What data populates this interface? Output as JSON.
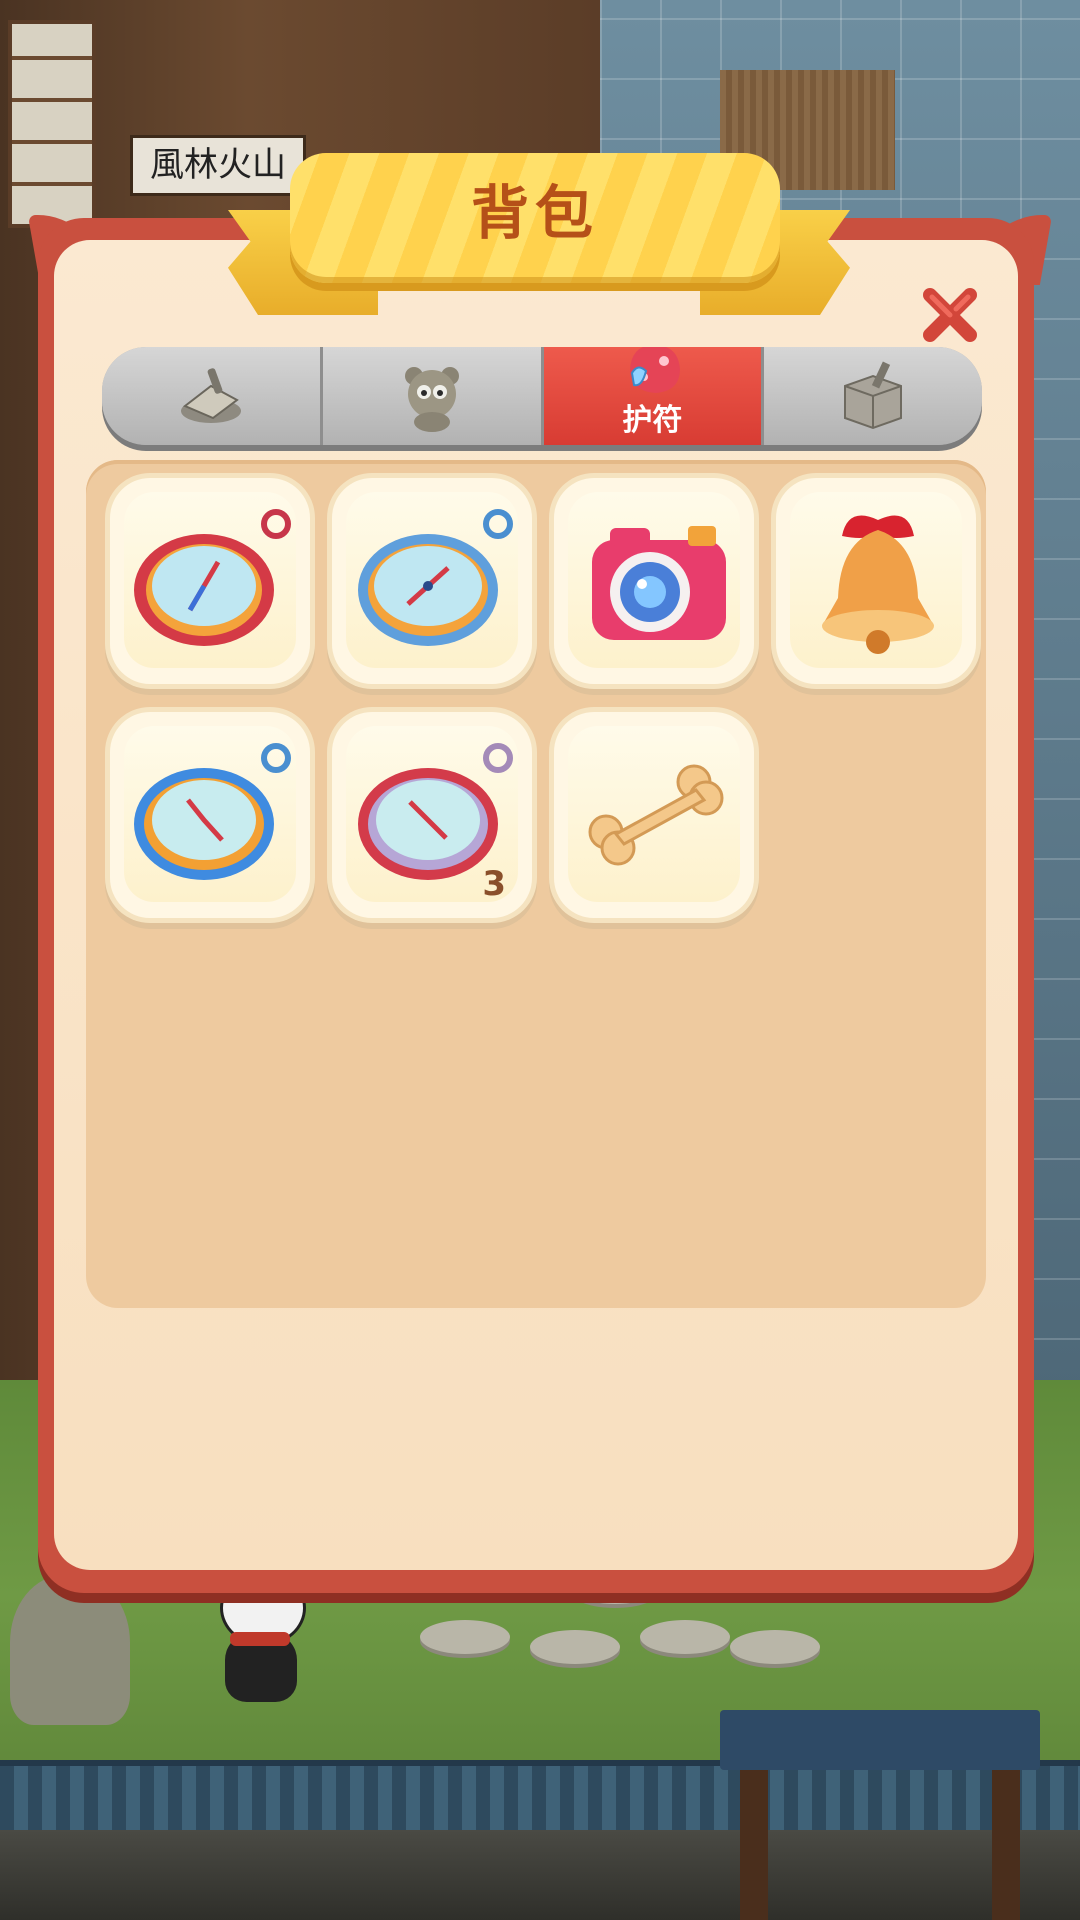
{
  "scene": {
    "sign_text": "風林火山"
  },
  "panel": {
    "title": "背包",
    "close_icon": "close-x-icon"
  },
  "tabs": [
    {
      "icon": "scroll-tools-icon",
      "label": "",
      "active": false
    },
    {
      "icon": "teddy-bear-icon",
      "label": "",
      "active": false
    },
    {
      "icon": "charm-pouch-icon",
      "label": "护符",
      "active": true
    },
    {
      "icon": "crate-icon",
      "label": "",
      "active": false
    }
  ],
  "items": [
    {
      "icon": "red-compass-icon",
      "count": ""
    },
    {
      "icon": "blue-compass-icon",
      "count": ""
    },
    {
      "icon": "pink-camera-icon",
      "count": ""
    },
    {
      "icon": "bell-icon",
      "count": ""
    },
    {
      "icon": "orange-compass-icon",
      "count": ""
    },
    {
      "icon": "silver-compass-icon",
      "count": "3"
    },
    {
      "icon": "bone-icon",
      "count": ""
    }
  ],
  "colors": {
    "panel_border": "#c9503f",
    "panel_fill": "#fbe9d1",
    "title_text": "#b55018",
    "active_tab": "#e04a3f",
    "ribbon": "#ffd24d"
  }
}
